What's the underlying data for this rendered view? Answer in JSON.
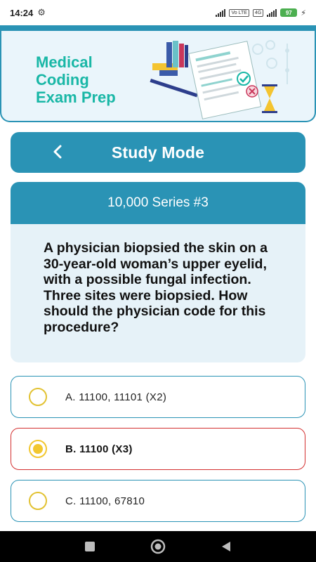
{
  "status_bar": {
    "time": "14:24",
    "network_tag_1": "Vo LTE",
    "network_tag_2": "4G",
    "battery_level": "97"
  },
  "banner": {
    "title_line1": "Medical",
    "title_line2": "Coding",
    "title_line3": "Exam Prep"
  },
  "header": {
    "back_icon": "chevron-left-icon",
    "title": "Study Mode"
  },
  "question": {
    "series": "10,000 Series #3",
    "text": "A physician biopsied the skin on a 30-year-old woman’s upper eyelid, with a possible fungal infection. Three sites were biopsied. How should the physician code for this procedure?"
  },
  "options": [
    {
      "label": "A. 11100, 11101 (X2)",
      "selected": false
    },
    {
      "label": "B. 11100 (X3)",
      "selected": true
    },
    {
      "label": "C. 11100, 67810",
      "selected": false
    }
  ],
  "colors": {
    "primary": "#2a93b5",
    "accent_title": "#19b7a6",
    "radio": "#f2c72f",
    "selected_border": "#d32f2f",
    "card_bg": "#e6f2f8"
  },
  "nav": {
    "recents_icon": "square-icon",
    "home_icon": "circle-home-icon",
    "back_icon": "triangle-back-icon"
  }
}
